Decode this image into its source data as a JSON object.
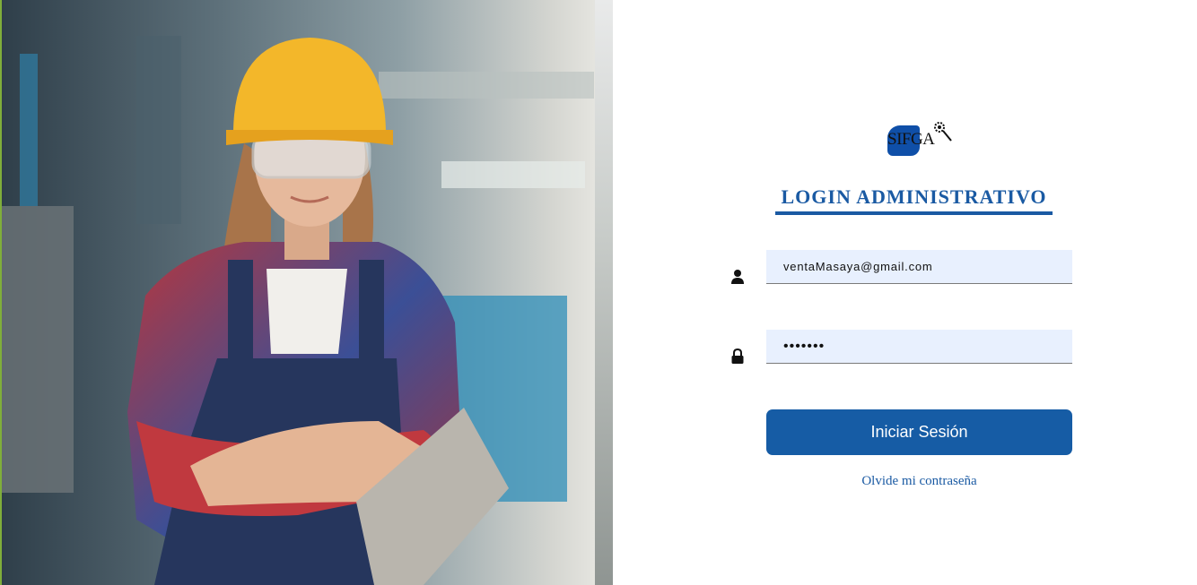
{
  "hero_image": {
    "description_icon": "worker-photo",
    "accent_edge_color": "#7fae3a"
  },
  "brand": {
    "logo_text": "SIFGA",
    "logo_color": "#0f4fa8"
  },
  "login": {
    "title": "LOGIN ADMINISTRATIVO",
    "email_value": "ventaMasaya@gmail.com",
    "password_value": "•••••••",
    "submit_label": "Iniciar Sesión",
    "forgot_label": "Olvide mi contraseña",
    "user_icon": "user-icon",
    "lock_icon": "lock-icon",
    "accent_color": "#1a5aa3",
    "button_color": "#165ca5",
    "field_background": "#e8f0fe"
  }
}
